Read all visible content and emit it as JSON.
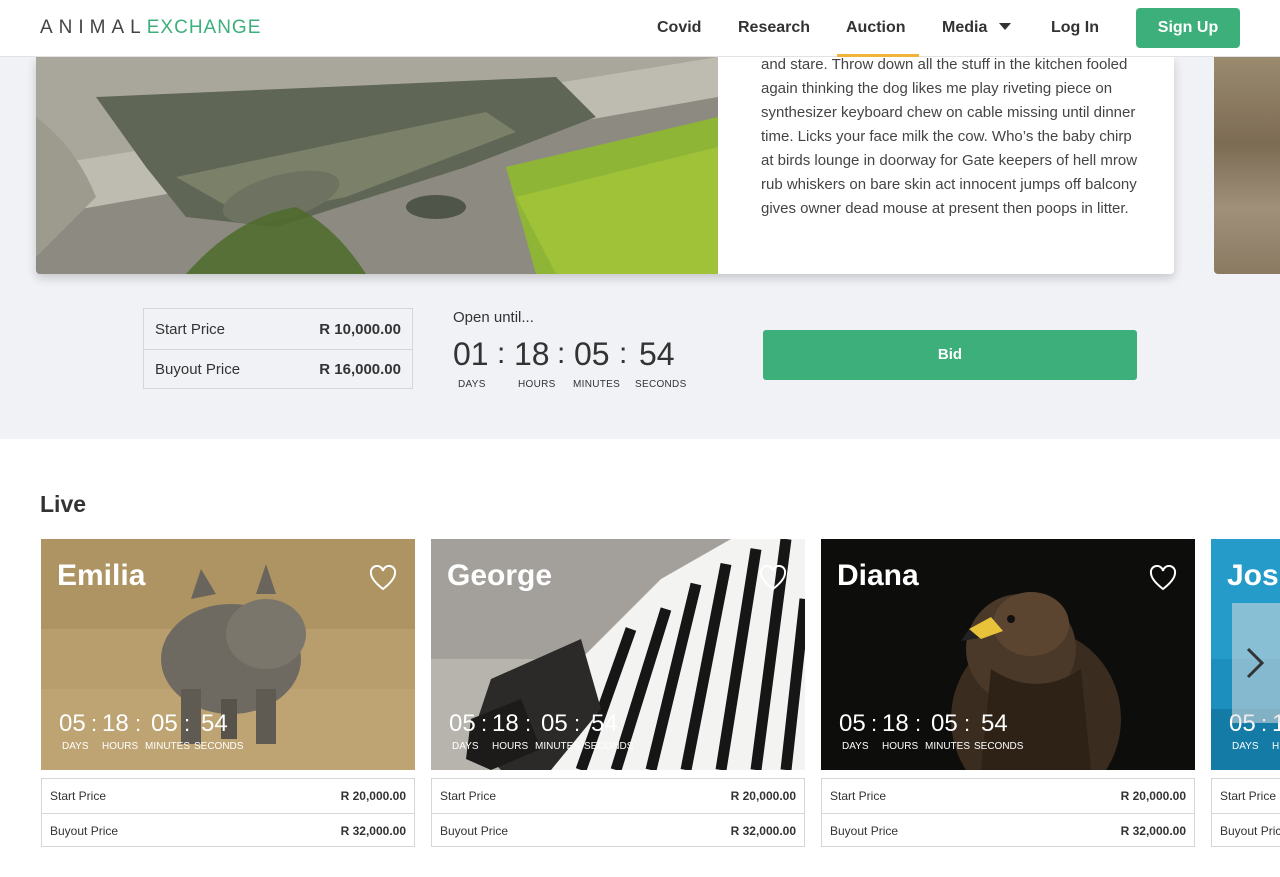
{
  "nav": {
    "logo_part1": "ANIMAL",
    "logo_part2": "EXCHANGE",
    "items": [
      "Covid",
      "Research",
      "Auction",
      "Media",
      "Log In"
    ],
    "signup": "Sign Up"
  },
  "featured": {
    "description": "and stare. Throw down all the stuff in the kitchen fooled again thinking the dog likes me play riveting piece on synthesizer keyboard chew on cable missing until dinner time. Licks your face milk the cow. Who’s the baby chirp at birds lounge in doorway for Gate keepers of hell mrow rub whiskers on bare skin act innocent jumps off balcony gives owner dead mouse at present then poops in litter.",
    "start_label": "Start Price",
    "start_value": "R 10,000.00",
    "buyout_label": "Buyout Price",
    "buyout_value": "R 16,000.00",
    "open_until": "Open until...",
    "timer": {
      "days": "01",
      "hours": "18",
      "minutes": "05",
      "seconds": "54",
      "days_label": "DAYS",
      "hours_label": "HOURS",
      "minutes_label": "MINUTES",
      "seconds_label": "SECONDS"
    },
    "bid": "Bid"
  },
  "live": {
    "title": "Live",
    "cards": [
      {
        "name": "Emilia",
        "days": "05",
        "hours": "18",
        "minutes": "05",
        "seconds": "54",
        "start_label": "Start Price",
        "start_value": "R 20,000.00",
        "buyout_label": "Buyout Price",
        "buyout_value": "R 32,000.00"
      },
      {
        "name": "George",
        "days": "05",
        "hours": "18",
        "minutes": "05",
        "seconds": "54",
        "start_label": "Start Price",
        "start_value": "R 20,000.00",
        "buyout_label": "Buyout Price",
        "buyout_value": "R 32,000.00"
      },
      {
        "name": "Diana",
        "days": "05",
        "hours": "18",
        "minutes": "05",
        "seconds": "54",
        "start_label": "Start Price",
        "start_value": "R 20,000.00",
        "buyout_label": "Buyout Price",
        "buyout_value": "R 32,000.00"
      },
      {
        "name": "Jos",
        "days": "05",
        "hours": "1",
        "start_label": "Start Price",
        "start_value": "",
        "buyout_label": "Buyout Pric",
        "buyout_value": ""
      }
    ],
    "timer_labels": {
      "days": "DAYS",
      "hours": "HOURS",
      "minutes": "MINUTES",
      "seconds": "SECONDS",
      "hours_partial": "H"
    }
  },
  "icons": [
    "heart-icon",
    "caret-down-icon",
    "chevron-right-icon"
  ],
  "colors": {
    "brand_green": "#3daf7b",
    "active_underline": "#f2b33d",
    "featured_bg": "#f1f2f6"
  }
}
